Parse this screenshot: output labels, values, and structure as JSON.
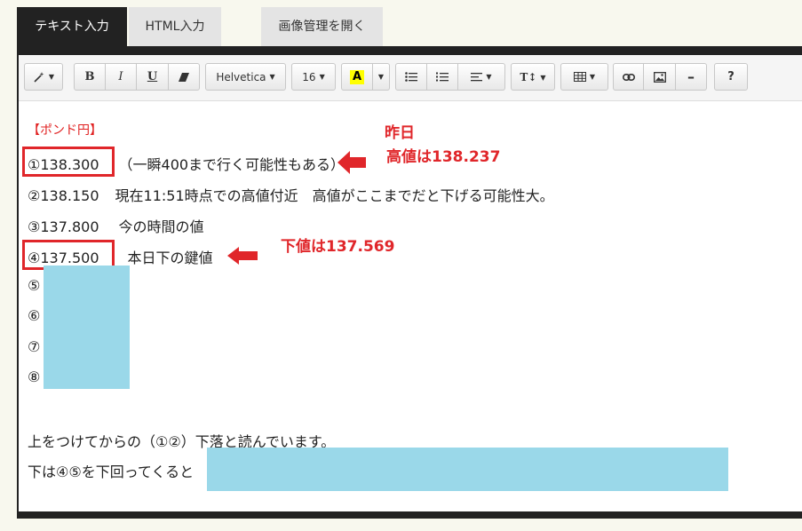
{
  "tabs": [
    {
      "label": "テキスト入力",
      "active": true
    },
    {
      "label": "HTML入力",
      "active": false
    },
    {
      "label": "画像管理を開く",
      "active": false
    }
  ],
  "toolbar": {
    "magic": "magic-wand-icon",
    "bold": "B",
    "italic": "I",
    "underline": "U",
    "eraser": "eraser-icon",
    "font_name": "Helvetica",
    "font_size": "16",
    "color_letter": "A",
    "ul": "unordered-list-icon",
    "ol": "ordered-list-icon",
    "align": "align-icon",
    "line_height": "T↕",
    "table": "table-icon",
    "link": "link-icon",
    "image": "image-icon",
    "hr": "–",
    "help": "?"
  },
  "content": {
    "heading": "【ポンド円】",
    "lines": [
      {
        "num": "①",
        "value": "138.300",
        "note": "（一瞬400まで行く可能性もある）"
      },
      {
        "num": "②",
        "value": "138.150",
        "note": "現在11:51時点での高値付近　高値がここまでだと下げる可能性大。"
      },
      {
        "num": "③",
        "value": "137.800",
        "note": "今の時間の値"
      },
      {
        "num": "④",
        "value": "137.500",
        "note": "本日下の鍵値"
      },
      {
        "num": "⑤"
      },
      {
        "num": "⑥"
      },
      {
        "num": "⑦"
      },
      {
        "num": "⑧"
      }
    ],
    "para1": "上をつけてからの（①②）下落と読んでいます。",
    "para2": "下は④⑤を下回ってくると"
  },
  "annotations": {
    "yesterday": "昨日",
    "high": "高値は138.237",
    "low": "下値は137.569"
  },
  "colors": {
    "annotation_red": "#e0262a",
    "mask_blue": "#9ad8e9",
    "active_tab": "#222222"
  }
}
